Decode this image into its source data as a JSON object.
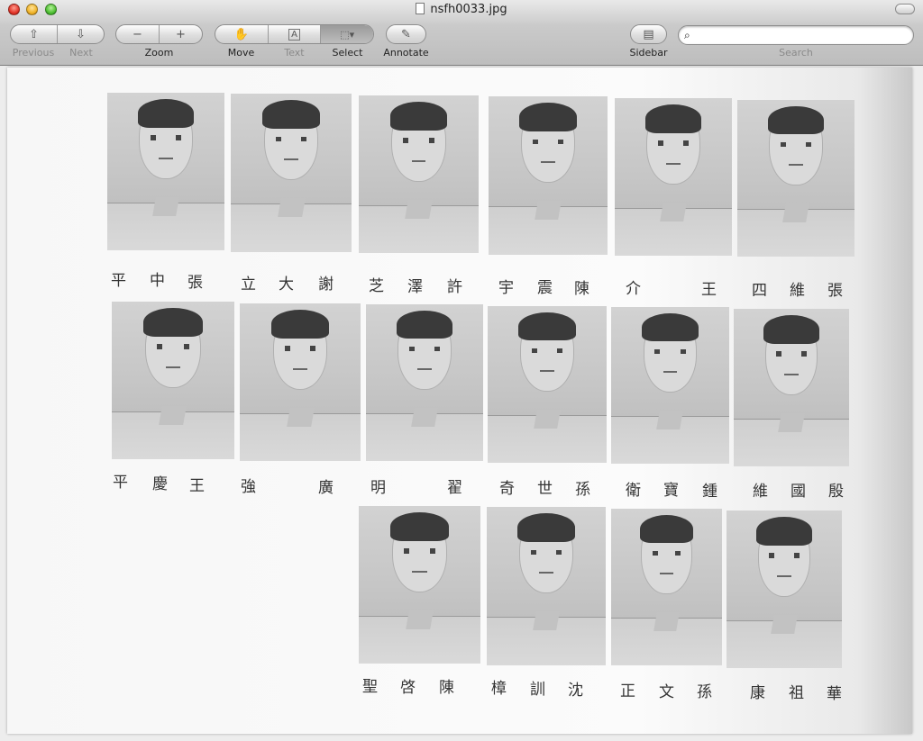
{
  "window": {
    "title": "nsfh0033.jpg"
  },
  "toolbar": {
    "nav": {
      "prev_label": "Previous",
      "next_label": "Next"
    },
    "zoom": {
      "label": "Zoom",
      "out_icon": "minus-icon",
      "in_icon": "plus-icon"
    },
    "move_label": "Move",
    "text_label": "Text",
    "select_label": "Select",
    "annotate_label": "Annotate",
    "sidebar_label": "Sidebar",
    "search": {
      "label": "Search",
      "value": ""
    }
  },
  "names": {
    "row1": [
      "平",
      "中",
      "張",
      "立",
      "大",
      "謝",
      "芝",
      "澤",
      "許",
      "宇",
      "震",
      "陳",
      "介",
      "王",
      "四",
      "維",
      "張"
    ],
    "row2": [
      "平",
      "慶",
      "王",
      "強",
      "廣",
      "明",
      "翟",
      "奇",
      "世",
      "孫",
      "衛",
      "寶",
      "鍾",
      "維",
      "國",
      "殷"
    ],
    "row3": [
      "聖",
      "啓",
      "陳",
      "樟",
      "訓",
      "沈",
      "正",
      "文",
      "孫",
      "康",
      "祖",
      "華"
    ]
  }
}
